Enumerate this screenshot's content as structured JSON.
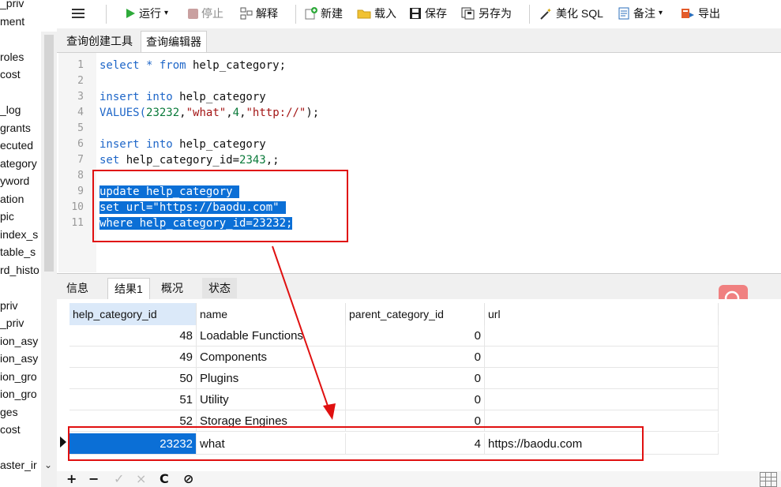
{
  "sidebar": {
    "items": [
      "_priv",
      "ment",
      "",
      "roles",
      "cost",
      "",
      "_log",
      "grants",
      "ecuted",
      "ategory",
      "yword",
      "ation",
      "pic",
      "index_s",
      "table_s",
      "rd_histo",
      "",
      "priv",
      "_priv",
      "ion_asy",
      "ion_asy",
      "ion_gro",
      "ion_gro",
      "ges",
      "cost",
      "",
      "aster_ir",
      "",
      "›"
    ]
  },
  "toolbar": {
    "menu_icon": "hamburger-icon",
    "run_label": "运行",
    "stop_label": "停止",
    "explain_label": "解释",
    "new_label": "新建",
    "load_label": "载入",
    "save_label": "保存",
    "saveas_label": "另存为",
    "beautify_label": "美化 SQL",
    "note_label": "备注",
    "export_label": "导出"
  },
  "tabs": [
    "查询创建工具",
    "查询编辑器"
  ],
  "editor": {
    "line_numbers": [
      "1",
      "2",
      "3",
      "4",
      "5",
      "6",
      "7",
      "8",
      "9",
      "10",
      "11"
    ],
    "lines": {
      "l1a": "select * ",
      "l1b": "from",
      "l1c": " help_category;",
      "l3a": "insert into",
      "l3b": " help_category",
      "l4a": "VALUES(",
      "l4b": "23232",
      "l4c": ",",
      "l4d": "\"what\"",
      "l4e": ",",
      "l4f": "4",
      "l4g": ",",
      "l4h": "\"http://\"",
      "l4i": ");",
      "l6a": "insert into",
      "l6b": " help_category",
      "l7a": "set",
      "l7b": " help_category_id=",
      "l7c": "2343",
      "l7d": ",;",
      "l9": "update help_category ",
      "l10": "set url=\"https://baodu.com\" ",
      "l11": "where help_category_id=23232;"
    }
  },
  "result_tabs": [
    "信息",
    "结果1",
    "概况",
    "状态"
  ],
  "table": {
    "columns": [
      "help_category_id",
      "name",
      "parent_category_id",
      "url"
    ],
    "rows": [
      {
        "id": "48",
        "name": "Loadable Functions",
        "parent": "0",
        "url": ""
      },
      {
        "id": "49",
        "name": "Components",
        "parent": "0",
        "url": ""
      },
      {
        "id": "50",
        "name": "Plugins",
        "parent": "0",
        "url": ""
      },
      {
        "id": "51",
        "name": "Utility",
        "parent": "0",
        "url": ""
      },
      {
        "id": "52",
        "name": "Storage Engines",
        "parent": "0",
        "url": ""
      },
      {
        "id": "23232",
        "name": "what",
        "parent": "4",
        "url": "https://baodu.com"
      }
    ]
  },
  "bottom": {
    "add": "+",
    "remove": "−",
    "apply": "✓",
    "discard": "×",
    "refresh": "C",
    "stop": "⊘"
  },
  "colors": {
    "accent": "#0b6fd6",
    "annotation_red": "#e01010",
    "search_badge": "#f08080"
  }
}
